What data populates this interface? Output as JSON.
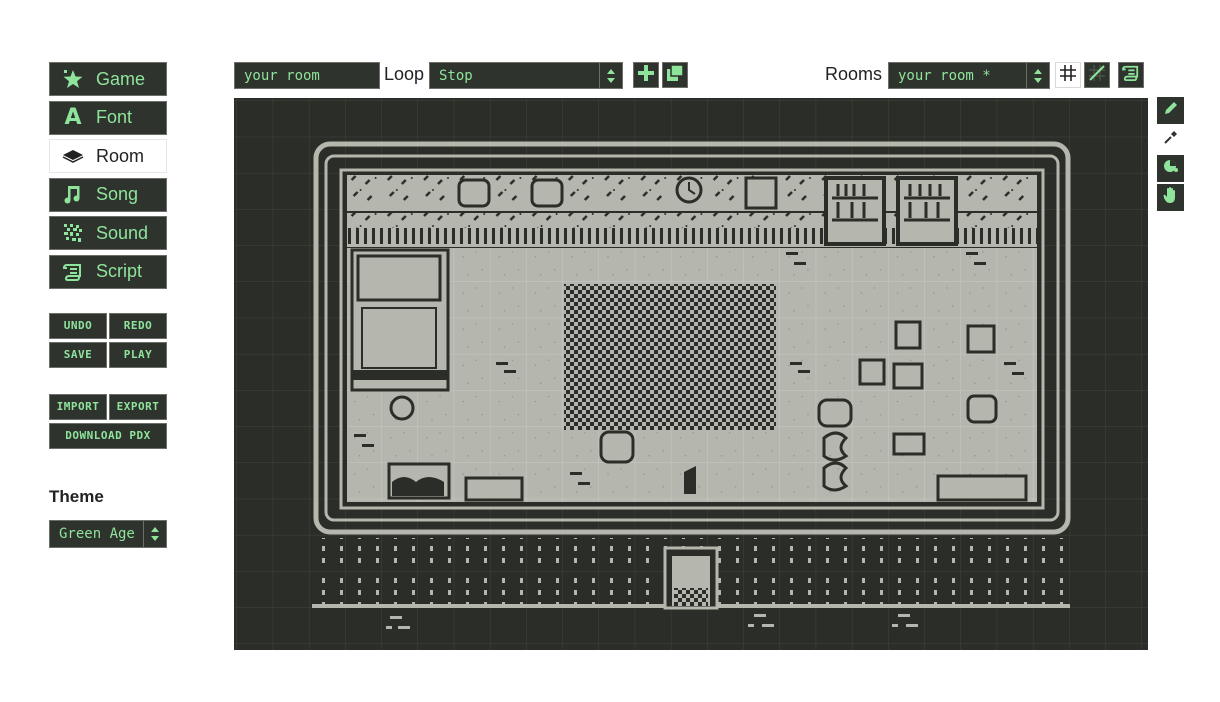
{
  "sidebar": {
    "nav": [
      {
        "label": "Game",
        "icon": "star-icon",
        "active": false
      },
      {
        "label": "Font",
        "icon": "font-icon",
        "active": false
      },
      {
        "label": "Room",
        "icon": "layers-icon",
        "active": true
      },
      {
        "label": "Song",
        "icon": "music-note-icon",
        "active": false
      },
      {
        "label": "Sound",
        "icon": "noise-icon",
        "active": false
      },
      {
        "label": "Script",
        "icon": "scroll-icon",
        "active": false
      }
    ],
    "history": {
      "undo": "UNDO",
      "redo": "REDO",
      "save": "SAVE",
      "play": "PLAY"
    },
    "files": {
      "import": "IMPORT",
      "export": "EXPORT",
      "download": "DOWNLOAD PDX"
    },
    "theme_label": "Theme",
    "theme_value": "Green Age"
  },
  "toolbar": {
    "room_name_value": "your room",
    "loop_label": "Loop",
    "loop_value": "Stop",
    "rooms_label": "Rooms",
    "rooms_value": "your room *"
  },
  "colors": {
    "accent": "#8fe49c",
    "panel": "#2f332d",
    "canvas_bg": "#2b2d28",
    "floor": "#b5b6ad",
    "ink": "#2b2d28"
  },
  "tools": [
    "pencil-icon",
    "eyedropper-icon",
    "fill-icon",
    "hand-icon"
  ]
}
